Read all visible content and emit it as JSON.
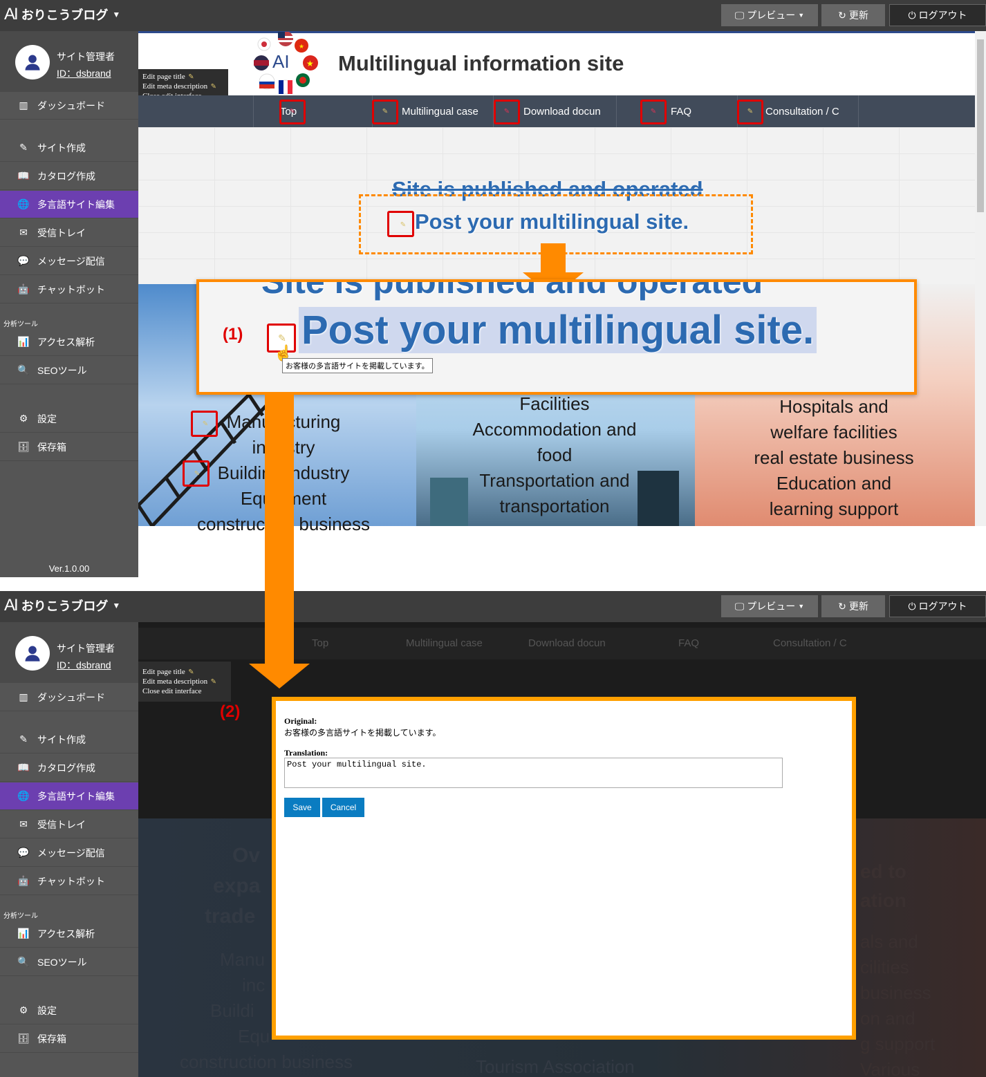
{
  "app": {
    "logo_mark": "AI",
    "logo_text": "おりこうブログ",
    "preview_label": "プレビュー",
    "refresh_label": "更新",
    "logout_label": "ログアウト"
  },
  "user": {
    "name": "サイト管理者",
    "id": "ID：dsbrand"
  },
  "sidebar": {
    "items": [
      {
        "label": "ダッシュボード",
        "icon": "dashboard-icon"
      },
      {
        "label": "サイト作成",
        "icon": "pencil-icon"
      },
      {
        "label": "カタログ作成",
        "icon": "book-icon"
      },
      {
        "label": "多言語サイト編集",
        "icon": "globe-icon"
      },
      {
        "label": "受信トレイ",
        "icon": "mail-icon"
      },
      {
        "label": "メッセージ配信",
        "icon": "chat-icon"
      },
      {
        "label": "チャットボット",
        "icon": "robot-icon"
      },
      {
        "label": "アクセス解析",
        "icon": "chart-icon"
      },
      {
        "label": "SEOツール",
        "icon": "search-icon"
      },
      {
        "label": "設定",
        "icon": "gear-icon"
      },
      {
        "label": "保存箱",
        "icon": "archive-icon"
      }
    ],
    "section_analysis": "分析ツール",
    "version": "Ver.1.0.00"
  },
  "edit_panel": {
    "page_title": "Edit page title",
    "meta_description": "Edit meta description",
    "close": "Close edit interface"
  },
  "site": {
    "title": "Multilingual information site",
    "nav": [
      "Top",
      "Multilingual case",
      "Download docun",
      "FAQ",
      "Consultation / C"
    ],
    "hero_line1": "Site is published and operated",
    "hero_line2": "Post your multilingual site.",
    "zoom_line1": "Site is published and operated",
    "zoom_line2": "Post your multilingual site.",
    "tooltip": "お客様の多言語サイトを掲載しています。",
    "panel1": [
      "Manufacturing",
      "industry",
      "Building industry",
      "Equipment",
      "construction business"
    ],
    "panel2": [
      "Facilities",
      "Accommodation and",
      "food",
      "Transportation and",
      "transportation"
    ],
    "panel3": [
      "Hospitals and",
      "welfare facilities",
      "real estate business",
      "Education and",
      "learning support"
    ]
  },
  "dim_site": {
    "left_lines": [
      "Ov",
      "expa",
      "trade"
    ],
    "panel1": [
      "Manu",
      "inc",
      "Buildi",
      "Equ",
      "construction business"
    ],
    "panel2": [
      "Tourism Association"
    ],
    "right_lines": [
      "ed to",
      "ation",
      "als and",
      "cilities",
      "business",
      "on and",
      "g support",
      "Various"
    ]
  },
  "steps": {
    "step1": "(1)",
    "step2": "(2)"
  },
  "modal": {
    "original_label": "Original:",
    "original_text": "お客様の多言語サイトを掲載しています。",
    "translation_label": "Translation:",
    "translation_value": "Post your multilingual site.",
    "save": "Save",
    "cancel": "Cancel"
  },
  "colors": {
    "accent_purple": "#6c3fb0",
    "orange": "#ff8a00",
    "highlight_red": "#e00000",
    "site_blue": "#2c6ab1",
    "button_blue": "#0a7cc1"
  }
}
